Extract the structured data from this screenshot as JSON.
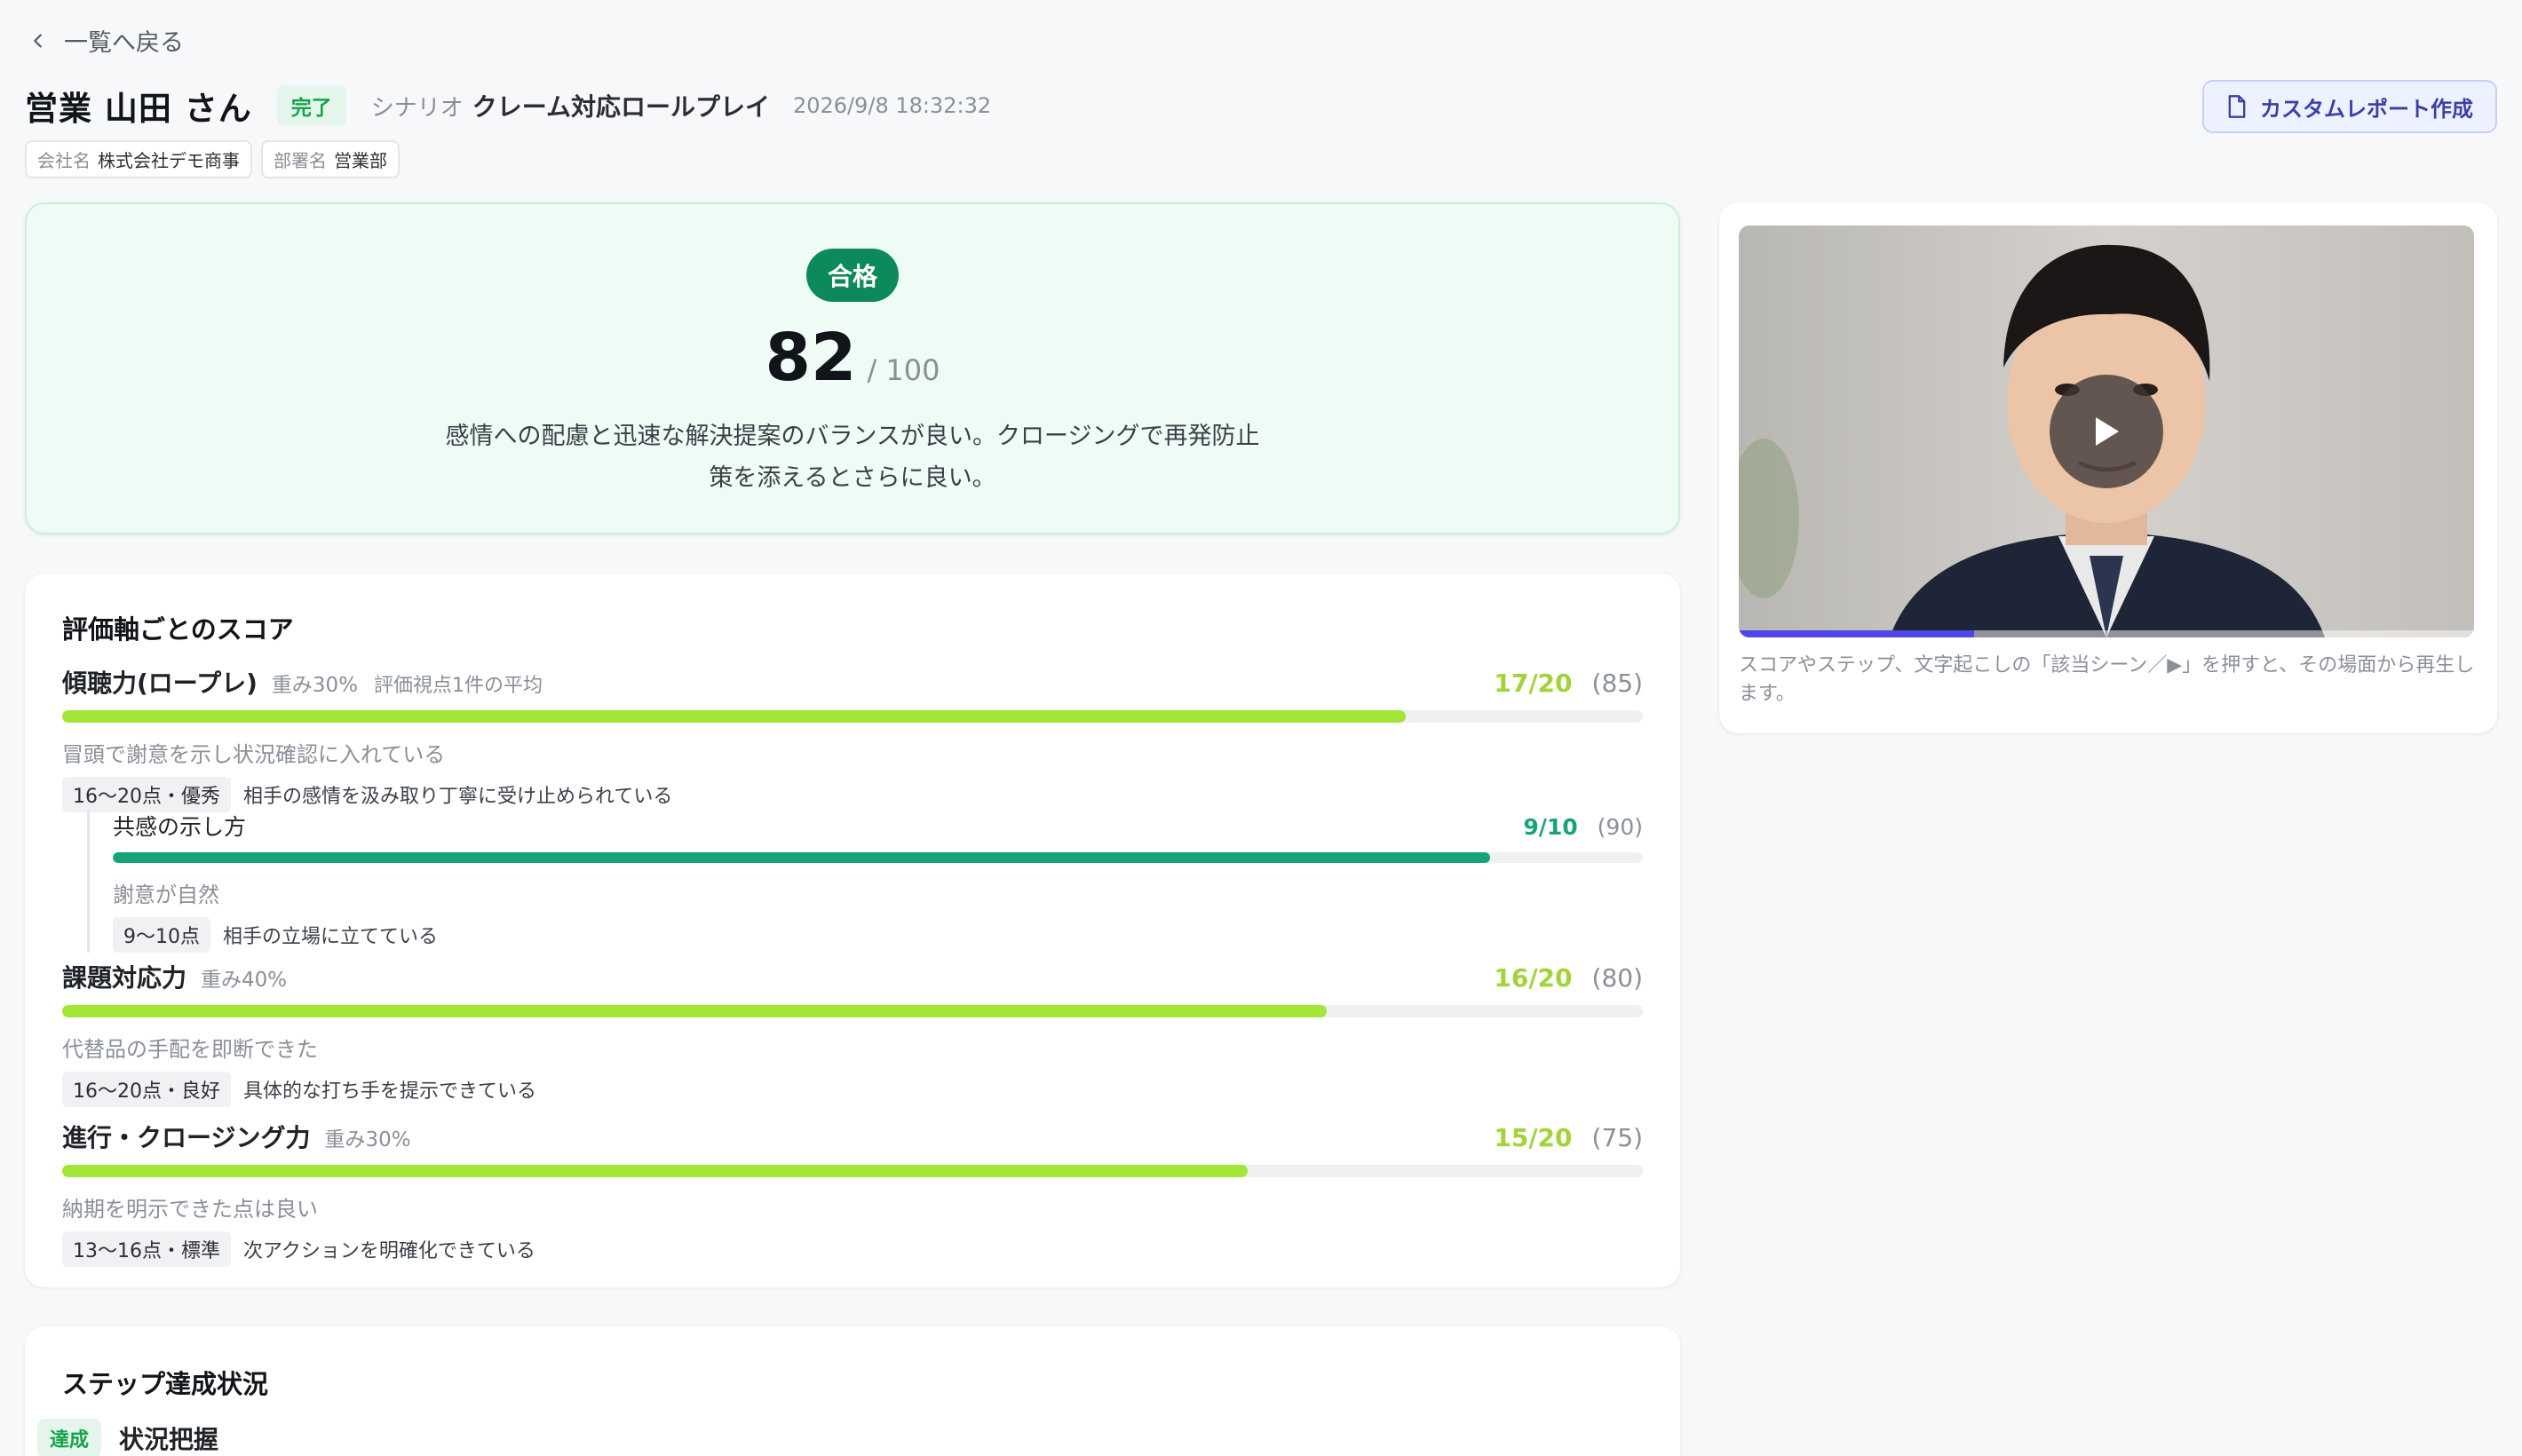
{
  "back_link": "一覧へ戻る",
  "header": {
    "user_name": "営業 山田 さん",
    "status": "完了",
    "scenario_label": "シナリオ",
    "scenario_name": "クレーム対応ロールプレイ",
    "datetime": "2026/9/8 18:32:32",
    "company_label": "会社名",
    "company_value": "株式会社デモ商事",
    "department_label": "部署名",
    "department_value": "営業部",
    "report_button": "カスタムレポート作成"
  },
  "result": {
    "badge": "合格",
    "score": "82",
    "score_total": "/ 100",
    "comment": "感情への配慮と迅速な解決提案のバランスが良い。クロージングで再発防止策を添えるとさらに良い。"
  },
  "axes": {
    "title": "評価軸ごとのスコア",
    "criteria": [
      {
        "name": "傾聴力(ロープレ)",
        "weight": "重み30%",
        "note": "評価視点1件の平均",
        "score": "17/20",
        "pct": "(85)",
        "fill": 0.85,
        "comment": "冒頭で謝意を示し状況確認に入れている",
        "band": "16〜20点・優秀",
        "band_desc": "相手の感情を汲み取り丁寧に受け止められている"
      },
      {
        "name": "課題対応力",
        "weight": "重み40%",
        "score": "16/20",
        "pct": "(80)",
        "fill": 0.8,
        "comment": "代替品の手配を即断できた",
        "band": "16〜20点・良好",
        "band_desc": "具体的な打ち手を提示できている"
      },
      {
        "name": "進行・クロージング力",
        "weight": "重み30%",
        "score": "15/20",
        "pct": "(75)",
        "fill": 0.75,
        "comment": "納期を明示できた点は良い",
        "band": "13〜16点・標準",
        "band_desc": "次アクションを明確化できている"
      }
    ],
    "sub": {
      "name": "共感の示し方",
      "score": "9/10",
      "pct": "(90)",
      "fill": 0.9,
      "comment": "謝意が自然",
      "band": "9〜10点",
      "band_desc": "相手の立場に立てている"
    }
  },
  "steps": {
    "title": "ステップ達成状況",
    "items": [
      {
        "status": "達成",
        "name": "状況把握"
      }
    ]
  },
  "video": {
    "progress": 0.32,
    "hint": "スコアやステップ、文字起こしの「該当シーン／▶」を押すと、その場面から再生します。"
  }
}
